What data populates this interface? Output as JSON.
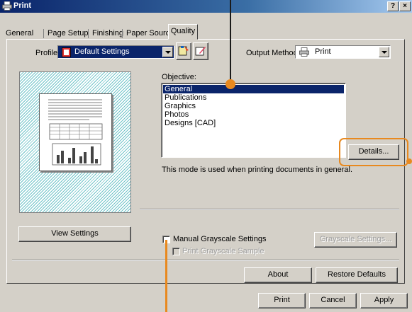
{
  "window": {
    "title": "Print",
    "help_label": "?",
    "close_label": "×"
  },
  "tabs": [
    "General",
    "Page Setup",
    "Finishing",
    "Paper Source",
    "Quality"
  ],
  "active_tab": "Quality",
  "profile": {
    "label": "Profile:",
    "value": "Default Settings"
  },
  "output_method": {
    "label": "Output Method:",
    "value": "Print"
  },
  "objective": {
    "label": "Objective:",
    "items": [
      "General",
      "Publications",
      "Graphics",
      "Photos",
      "Designs [CAD]"
    ],
    "selected": "General",
    "details_button": "Details...",
    "description": "This mode is used when printing documents in general."
  },
  "view_settings_button": "View Settings",
  "grayscale": {
    "manual_label": "Manual Grayscale Settings",
    "manual_checked": false,
    "print_sample_label": "Print Grayscale Sample",
    "settings_button": "Grayscale Settings..."
  },
  "about_button": "About",
  "restore_defaults_button": "Restore Defaults",
  "footer": {
    "print": "Print",
    "cancel": "Cancel",
    "apply": "Apply"
  },
  "colors": {
    "titlebar": "#0a246a",
    "selection": "#0a246a",
    "callout": "#e8891f",
    "dialog_bg": "#d4d0c8"
  }
}
